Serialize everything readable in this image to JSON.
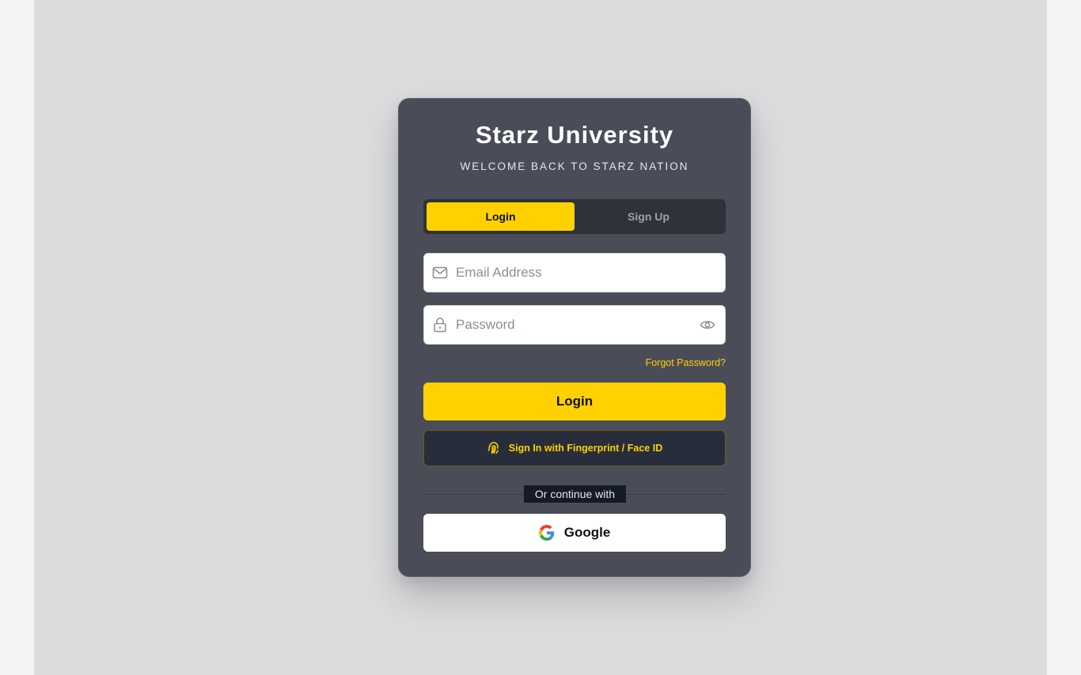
{
  "header": {
    "title": "Starz University",
    "subtitle": "WELCOME BACK TO STARZ NATION"
  },
  "tabs": [
    {
      "label": "Login",
      "active": true
    },
    {
      "label": "Sign Up",
      "active": false
    }
  ],
  "form": {
    "email": {
      "placeholder": "Email Address",
      "value": "",
      "icon": "mail-icon"
    },
    "password": {
      "placeholder": "Password",
      "value": "",
      "icon": "lock-icon",
      "toggle_icon": "eye-icon"
    },
    "forgot_label": "Forgot Password?",
    "login_label": "Login",
    "biometric_label": "Sign In with Fingerprint / Face ID",
    "biometric_icon": "fingerprint-icon"
  },
  "social": {
    "divider_label": "Or continue with",
    "google_label": "Google",
    "google_icon": "google-icon"
  },
  "colors": {
    "accent": "#ffd100",
    "card": "#4a4d57",
    "page": "#dbdcde"
  }
}
